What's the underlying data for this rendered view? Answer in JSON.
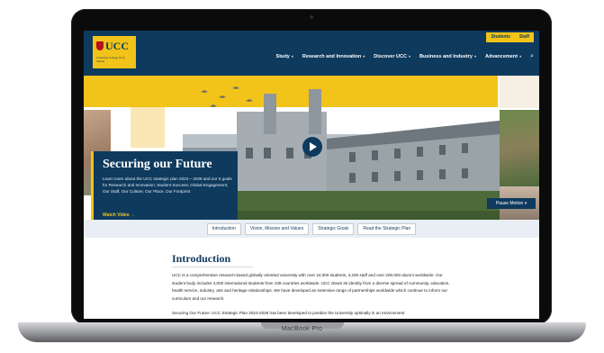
{
  "device": {
    "label": "MacBook Pro"
  },
  "header": {
    "logo_text": "UCC",
    "logo_sub": "University College Cork, Ireland",
    "top_links": [
      "Students",
      "Staff"
    ],
    "nav": [
      {
        "label": "Study"
      },
      {
        "label": "Research and Innovation"
      },
      {
        "label": "Discover UCC"
      },
      {
        "label": "Business and Industry"
      },
      {
        "label": "Advancement"
      }
    ]
  },
  "hero": {
    "title": "Securing our Future",
    "text": "Learn more about the UCC strategic plan 2023 – 2028 and our 5 goals for Research and Innovation; Student Success; Global Engagement; Our Staff, Our Culture; Our Place, Our Footprint",
    "link": "Watch Video →",
    "pause": "Pause Motion ⏸"
  },
  "tabs": [
    "Introduction",
    "Vision, Mission and Values",
    "Strategic Goals",
    "Read the Strategic Plan"
  ],
  "content": {
    "title": "Introduction",
    "p1": "UCC is a comprehensive research-based globally oriented university with over 24,000 students, 3,200 staff and over 200,000 alumni worldwide. Our student body includes 4,000 international students from 108 countries worldwide. UCC draws its identity from a diverse spread of community, education, health service, industry, arts and heritage relationships. We have developed an extensive range of partnerships worldwide which continue to inform our curriculum and our research.",
    "p2": "Securing Our Future: UCC Strategic Plan 2023-2028 has been developed to position the University optimally in an environment"
  },
  "colors": {
    "navy": "#0e3a5e",
    "gold": "#f2c318"
  }
}
